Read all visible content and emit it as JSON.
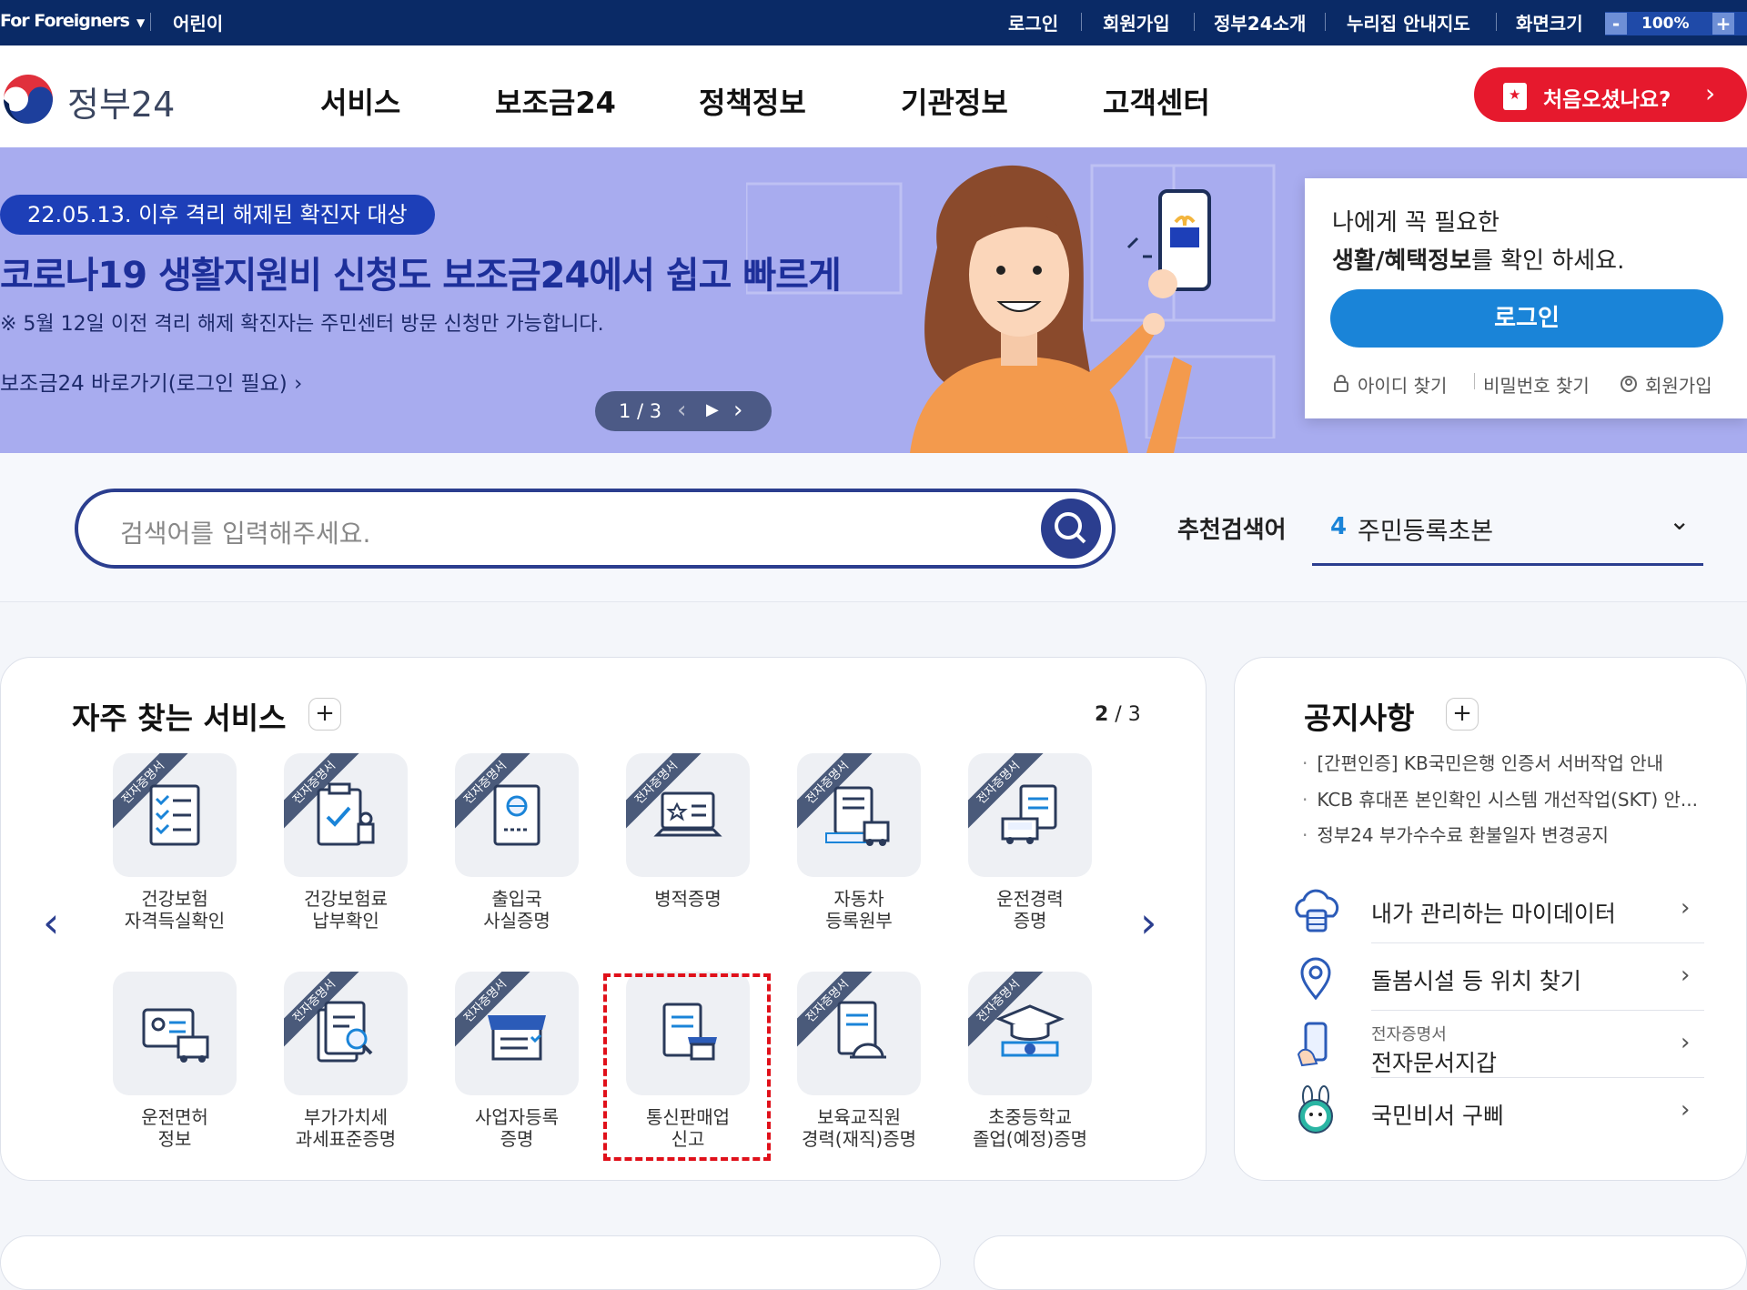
{
  "topbar": {
    "lang_label": "For Foreigners",
    "kids_label": "어린이",
    "login": "로그인",
    "signup": "회원가입",
    "about": "정부24소개",
    "map": "누리집 안내지도",
    "zoom_label": "화면크기",
    "zoom_minus": "-",
    "zoom_value": "100%",
    "zoom_plus": "+"
  },
  "header": {
    "logo_text": "정부24",
    "nav": [
      "서비스",
      "보조금24",
      "정책정보",
      "기관정보",
      "고객센터"
    ],
    "cta_label": "처음오셨나요?",
    "cta_arrow": "›"
  },
  "hero": {
    "pill": "22.05.13. 이후 격리 해제된 확진자 대상",
    "title": "코로나19 생활지원비 신청도 보조금24에서 쉽고 빠르게",
    "note": "※ 5월 12일 이전 격리 해제 확진자는 주민센터 방문 신청만 가능합니다.",
    "link": "보조금24 바로가기(로그인 필요) ›",
    "pager": "1 / 3",
    "pager_prev": "‹",
    "pager_play": "▶",
    "pager_next": "›"
  },
  "login_card": {
    "line1": "나에게 꼭 필요한",
    "line2_bold": "생활/혜택정보",
    "line2_rest": "를 확인 하세요.",
    "button": "로그인",
    "find_id": "아이디 찾기",
    "find_pw": "비밀번호 찾기",
    "join": "회원가입"
  },
  "search": {
    "placeholder": "검색어를 입력해주세요.",
    "rec_label": "추천검색어",
    "rec_num": "4",
    "rec_term": "주민등록초본",
    "rec_dropdown": "⌄"
  },
  "services": {
    "title": "자주 찾는 서비스",
    "plus": "+",
    "page_current": "2",
    "page_total": " / 3",
    "ribbon": "전자증명서",
    "prev": "‹",
    "next": "›",
    "tiles": [
      {
        "l1": "건강보험",
        "l2": "자격득실확인",
        "icon": "checklist-icon"
      },
      {
        "l1": "건강보험료",
        "l2": "납부확인",
        "icon": "clipboard-stamp-icon"
      },
      {
        "l1": "출입국",
        "l2": "사실증명",
        "icon": "passport-icon"
      },
      {
        "l1": "병적증명",
        "l2": "",
        "icon": "laptop-star-icon"
      },
      {
        "l1": "자동차",
        "l2": "등록원부",
        "icon": "car-document-icon"
      },
      {
        "l1": "운전경력",
        "l2": "증명",
        "icon": "car-record-icon"
      },
      {
        "l1": "운전면허",
        "l2": "정보",
        "icon": "license-card-icon"
      },
      {
        "l1": "부가가치세",
        "l2": "과세표준증명",
        "icon": "document-search-icon"
      },
      {
        "l1": "사업자등록",
        "l2": "증명",
        "icon": "storefront-icon"
      },
      {
        "l1": "통신판매업",
        "l2": "신고",
        "icon": "document-shop-icon"
      },
      {
        "l1": "보육교직원",
        "l2": "경력(재직)증명",
        "icon": "document-helmet-icon"
      },
      {
        "l1": "초중등학교",
        "l2": "졸업(예정)증명",
        "icon": "graduation-cap-icon"
      }
    ]
  },
  "notice": {
    "title": "공지사항",
    "plus": "+",
    "items": [
      "[간편인증] KB국민은행 인증서 서버작업 안내",
      "KCB 휴대폰 본인확인 시스템 개선작업(SKT) 안...",
      "정부24 부가수수료 환불일자 변경공지"
    ],
    "links": [
      {
        "text": "내가 관리하는 마이데이터",
        "icon": "cloud-data-icon"
      },
      {
        "text": "돌봄시설 등 위치 찾기",
        "icon": "location-pin-icon"
      },
      {
        "small": "전자증명서",
        "text": "전자문서지갑",
        "icon": "phone-wallet-icon"
      },
      {
        "text": "국민비서 구삐",
        "icon": "rabbit-mascot-icon"
      }
    ],
    "arrow": "›"
  },
  "colors": {
    "topbar": "#0a2a66",
    "hero_bg": "#a8acef",
    "cta": "#e6192d",
    "login": "#1a84d8",
    "search_border": "#2b3e8f",
    "highlight": "#e0101a"
  }
}
